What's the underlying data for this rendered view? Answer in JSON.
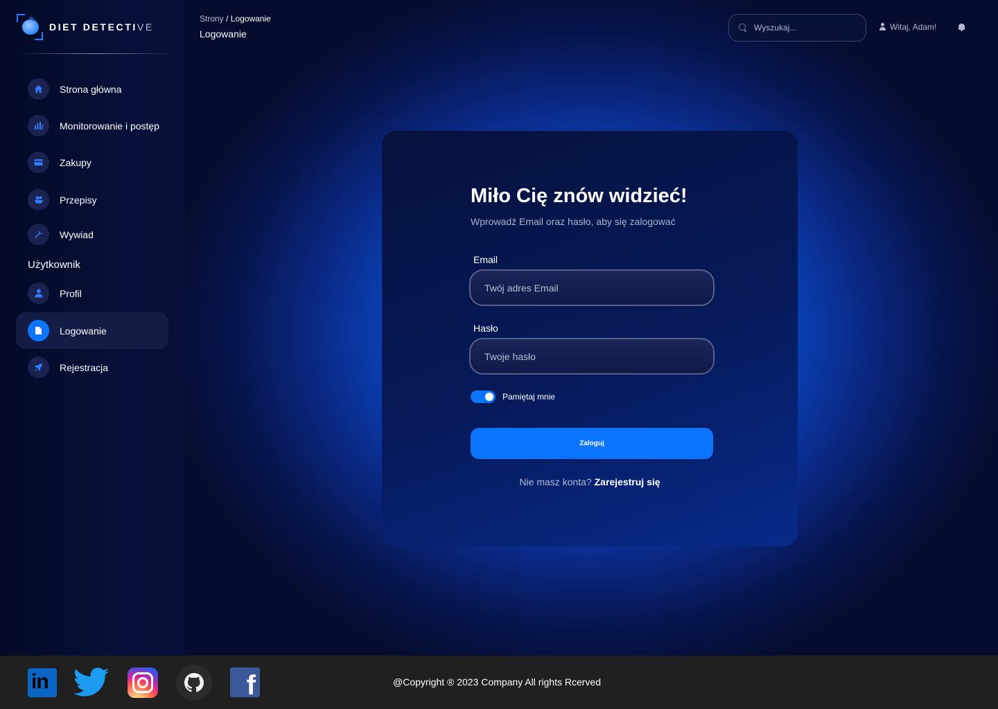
{
  "brand": {
    "name_main": "DIET DETECTI",
    "name_fade": "VE"
  },
  "sidebar": {
    "items": [
      {
        "label": "Strona główna",
        "icon": "home-icon"
      },
      {
        "label": "Monitorowanie i postęp",
        "icon": "chart-icon"
      },
      {
        "label": "Zakupy",
        "icon": "card-icon"
      },
      {
        "label": "Przepisy",
        "icon": "food-icon"
      },
      {
        "label": "Wywiad",
        "icon": "wrench-icon"
      }
    ],
    "section_title": "Użytkownik",
    "user_items": [
      {
        "label": "Profil",
        "icon": "user-icon",
        "active": false
      },
      {
        "label": "Logowanie",
        "icon": "document-icon",
        "active": true
      },
      {
        "label": "Rejestracja",
        "icon": "rocket-icon",
        "active": false
      }
    ]
  },
  "header": {
    "breadcrumb_root": "Strony",
    "breadcrumb_sep": "/",
    "breadcrumb_current": "Logowanie",
    "title": "Logowanie",
    "search_placeholder": "Wyszukaj...",
    "greeting": "Witaj, Adam!"
  },
  "login": {
    "title": "Miło Cię znów widzieć!",
    "subtitle": "Wprowadź Email oraz hasło, aby się zalogować",
    "email_label": "Email",
    "email_placeholder": "Twój adres Email",
    "password_label": "Hasło",
    "password_placeholder": "Twoje hasło",
    "remember_label": "Pamiętaj mnie",
    "remember_on": true,
    "submit_label": "Zaloguj",
    "signup_prompt": "Nie masz konta?",
    "signup_link": "Zarejestruj się"
  },
  "footer": {
    "social": [
      "linkedin-icon",
      "twitter-icon",
      "instagram-icon",
      "github-icon",
      "facebook-icon"
    ],
    "copyright": "@Copyright ® 2023 Company All rights Rcerved"
  },
  "colors": {
    "accent": "#0b75ff",
    "background": "#050c2e",
    "footer": "#202020"
  }
}
